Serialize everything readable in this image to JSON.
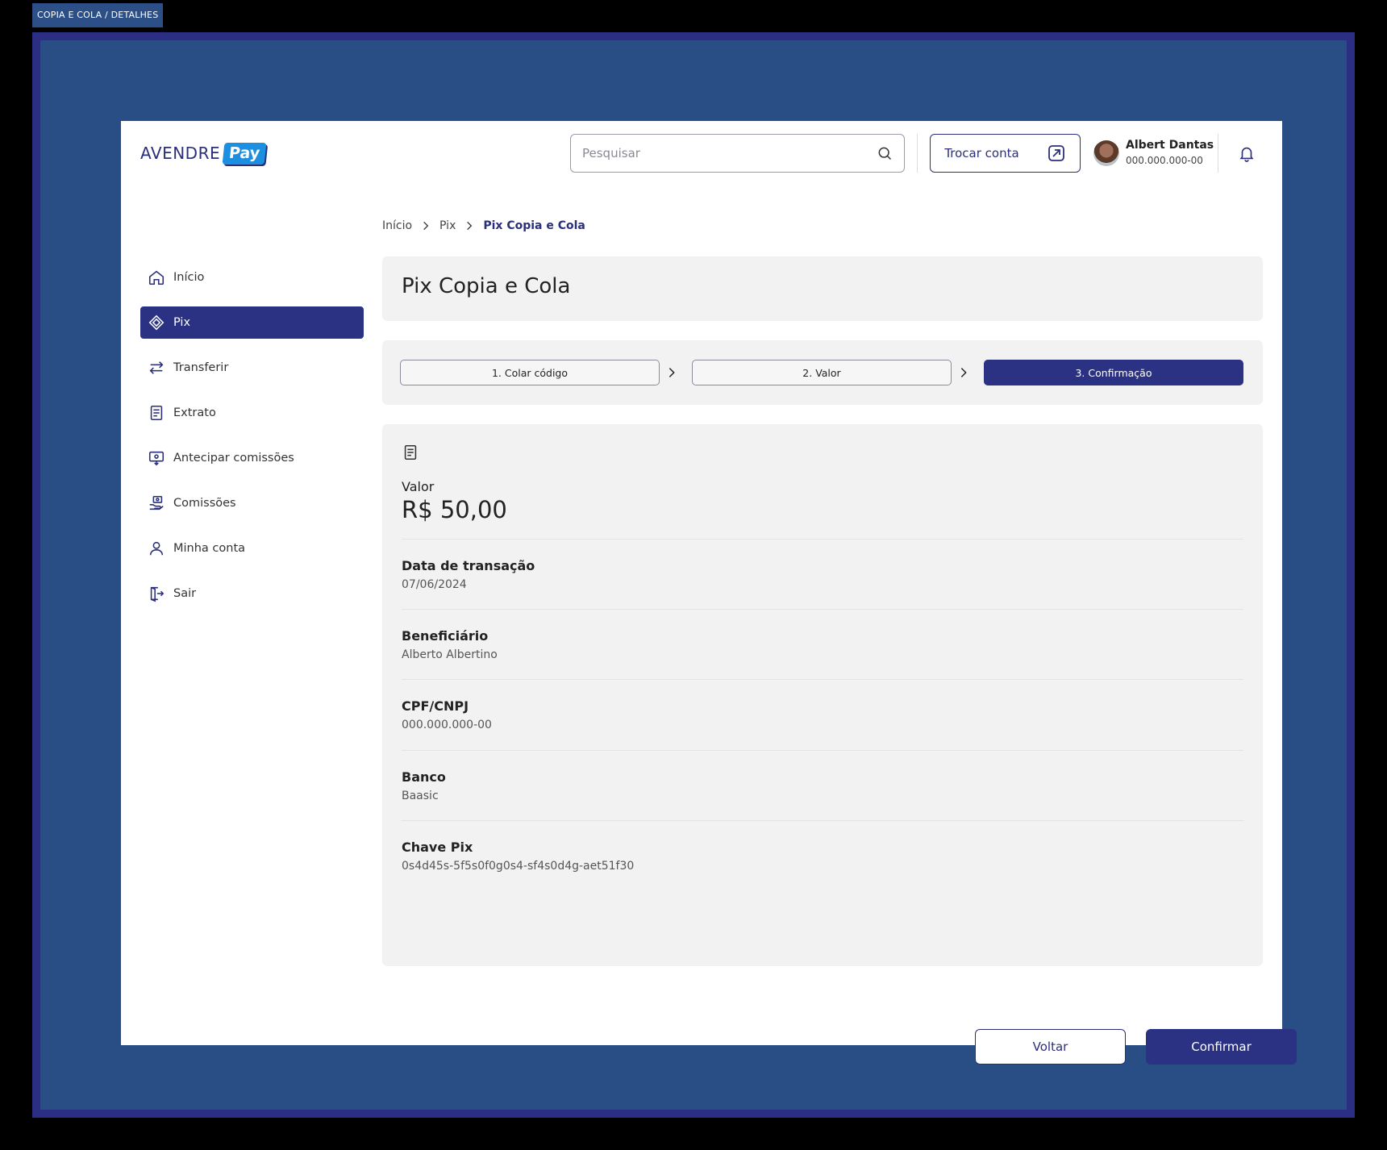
{
  "frame_label": "COPIA E COLA / DETALHES",
  "header": {
    "logo_text": "AVENDRE",
    "logo_badge": "Pay",
    "search_placeholder": "Pesquisar",
    "switch_account_label": "Trocar conta",
    "user": {
      "name": "Albert Dantas",
      "document": "000.000.000-00"
    }
  },
  "sidebar": {
    "items": [
      {
        "label": "Início",
        "icon": "home-icon"
      },
      {
        "label": "Pix",
        "icon": "pix-icon",
        "active": true
      },
      {
        "label": "Transferir",
        "icon": "transfer-icon"
      },
      {
        "label": "Extrato",
        "icon": "statement-icon"
      },
      {
        "label": "Antecipar comissões",
        "icon": "advance-commission-icon"
      },
      {
        "label": "Comissões",
        "icon": "commission-icon"
      },
      {
        "label": "Minha conta",
        "icon": "user-icon"
      },
      {
        "label": "Sair",
        "icon": "logout-icon"
      }
    ]
  },
  "breadcrumb": [
    "Início",
    "Pix",
    "Pix Copia e Cola"
  ],
  "page_title": "Pix Copia e Cola",
  "steps": [
    {
      "label": "1. Colar código",
      "active": false
    },
    {
      "label": "2. Valor",
      "active": false
    },
    {
      "label": "3. Confirmação",
      "active": true
    }
  ],
  "details": {
    "amount_label": "Valor",
    "amount_value": "R$ 50,00",
    "fields": [
      {
        "label": "Data de transação",
        "value": "07/06/2024"
      },
      {
        "label": "Beneficiário",
        "value": "Alberto Albertino"
      },
      {
        "label": "CPF/CNPJ",
        "value": "000.000.000-00"
      },
      {
        "label": "Banco",
        "value": "Baasic"
      },
      {
        "label": "Chave Pix",
        "value": "0s4d45s-5f5s0f0g0s4-sf4s0d4g-aet51f30"
      }
    ]
  },
  "actions": {
    "back_label": "Voltar",
    "confirm_label": "Confirmar"
  },
  "colors": {
    "primary": "#2b3283",
    "brand_blue": "#1d8fe0",
    "panel": "#f2f2f2",
    "backdrop": "#284e85"
  }
}
